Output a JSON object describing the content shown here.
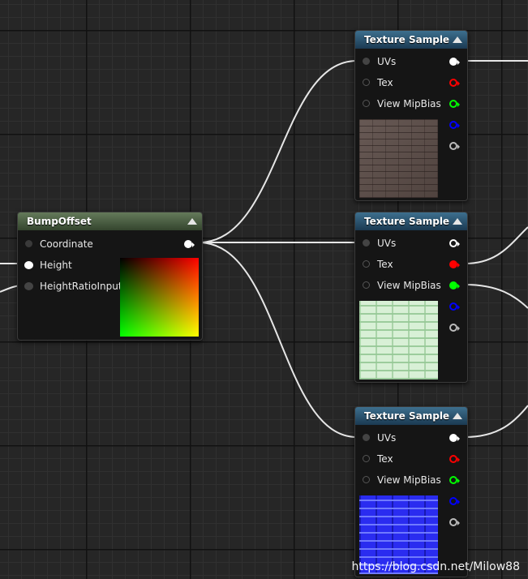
{
  "nodes": {
    "bump": {
      "title": "BumpOffset",
      "inputs": [
        "Coordinate",
        "Height",
        "HeightRatioInput"
      ]
    },
    "tex1": {
      "title": "Texture Sample",
      "inputs": [
        "UVs",
        "Tex",
        "View MipBias"
      ]
    },
    "tex2": {
      "title": "Texture Sample",
      "inputs": [
        "UVs",
        "Tex",
        "View MipBias"
      ]
    },
    "tex3": {
      "title": "Texture Sample",
      "inputs": [
        "UVs",
        "Tex",
        "View MipBias"
      ]
    }
  },
  "colors": {
    "wire": "#e6e6e6",
    "texture_header": "#2c5775",
    "bump_header": "#4d6344",
    "pin_white": "#ffffff",
    "pin_red": "#ff0000",
    "pin_green": "#00ff00",
    "pin_blue": "#0000ff",
    "pin_gray": "#bbbbbb"
  },
  "watermark": "https://blog.csdn.net/Milow88"
}
